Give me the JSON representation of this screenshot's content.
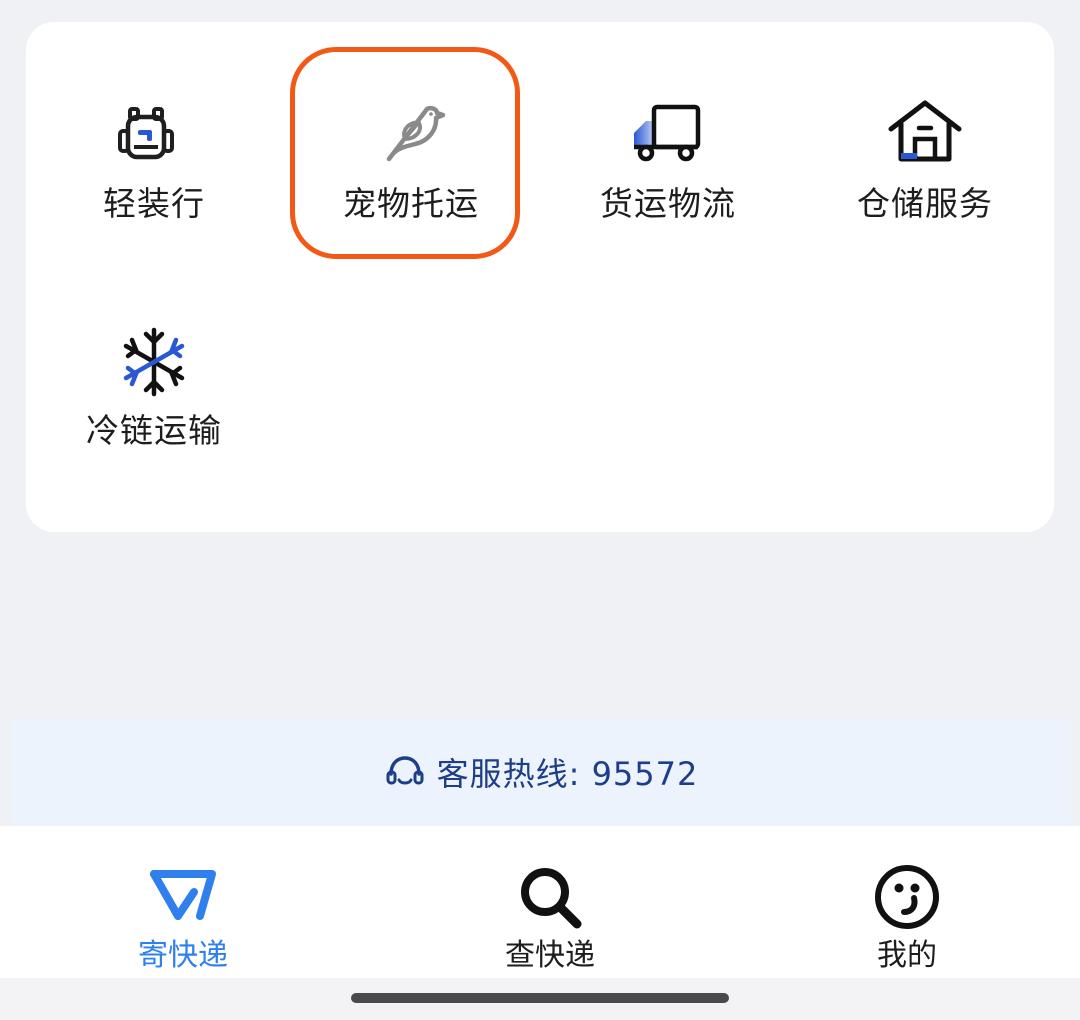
{
  "services": [
    {
      "label": "轻装行",
      "icon": "backpack-icon"
    },
    {
      "label": "宠物托运",
      "icon": "bird-icon",
      "highlighted": true
    },
    {
      "label": "货运物流",
      "icon": "truck-icon"
    },
    {
      "label": "仓储服务",
      "icon": "warehouse-icon"
    },
    {
      "label": "冷链运输",
      "icon": "snowflake-icon"
    }
  ],
  "hotline": {
    "text": "客服热线: 95572",
    "icon": "headset-icon"
  },
  "tabs": [
    {
      "label": "寄快递",
      "icon": "send-icon",
      "active": true
    },
    {
      "label": "查快递",
      "icon": "search-icon",
      "active": false
    },
    {
      "label": "我的",
      "icon": "smiley-icon",
      "active": false
    }
  ],
  "colors": {
    "background": "#eff1f5",
    "card": "#ffffff",
    "highlight_border": "#f15a16",
    "accent_blue": "#2f80ed",
    "icon_blue": "#2a57d4",
    "hotline_bg": "#edf3fd",
    "hotline_text": "#1d3e88",
    "text_dark": "#1d1d1f"
  }
}
